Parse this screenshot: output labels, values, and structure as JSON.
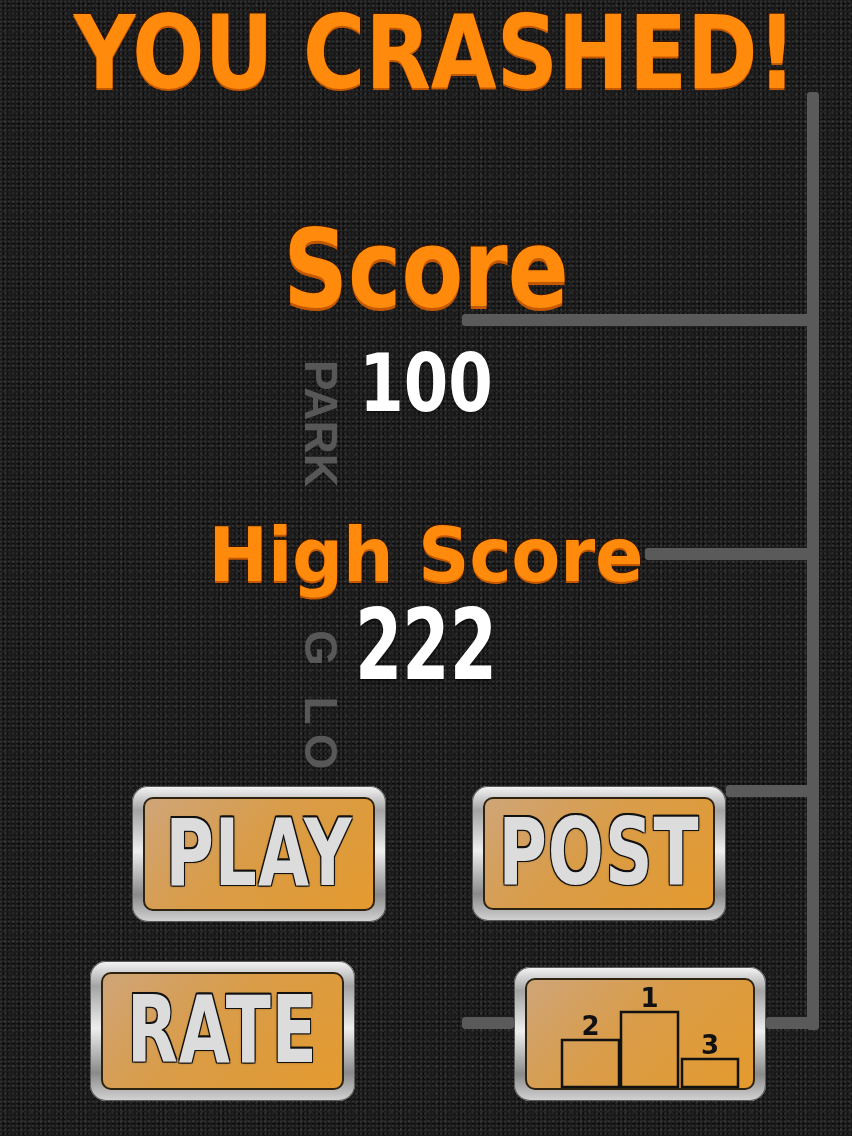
{
  "title": "YOU CRASHED!",
  "ground_marking": {
    "segments": [
      "PARK",
      "G LO"
    ]
  },
  "score": {
    "label": "Score",
    "value": "100"
  },
  "high_score": {
    "label": "High Score",
    "value": "222"
  },
  "buttons": [
    {
      "kind": "text",
      "label": "PLAY"
    },
    {
      "kind": "text",
      "label": "POST"
    },
    {
      "kind": "text",
      "label": "RATE"
    },
    {
      "kind": "podium",
      "places": [
        "2",
        "1",
        "3"
      ]
    }
  ]
}
